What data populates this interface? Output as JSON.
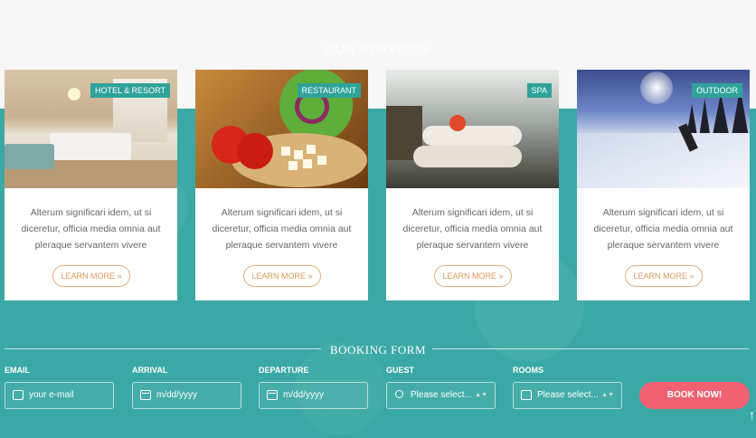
{
  "services": {
    "title": "OUR SERVICES",
    "cards": [
      {
        "tag": "HOTEL & RESORT",
        "description": "Alterum significari idem, ut si diceretur, officia media omnia aut pleraque servantem vivere",
        "button": "LEARN MORE »"
      },
      {
        "tag": "RESTAURANT",
        "description": "Alterum significari idem, ut si diceretur, officia media omnia aut pleraque servantem vivere",
        "button": "LEARN MORE »"
      },
      {
        "tag": "SPA",
        "description": "Alterum significari idem, ut si diceretur, officia media omnia aut pleraque servantem vivere",
        "button": "LEARN MORE »"
      },
      {
        "tag": "OUTDOOR",
        "description": "Alterum significari idem, ut si diceretur, officia media omnia aut pleraque servantem vivere",
        "button": "LEARN MORE »"
      }
    ]
  },
  "booking": {
    "title": "BOOKING FORM",
    "fields": [
      {
        "label": "EMAIL",
        "placeholder": "your e-mail",
        "icon": "envelope-icon"
      },
      {
        "label": "ARRIVAL",
        "placeholder": "m/dd/yyyy",
        "icon": "calendar-icon"
      },
      {
        "label": "DEPARTURE",
        "placeholder": "m/dd/yyyy",
        "icon": "calendar-icon"
      },
      {
        "label": "GUEST",
        "placeholder": "Please select...",
        "icon": "user-icon"
      },
      {
        "label": "ROOMS",
        "placeholder": "Please select...",
        "icon": "bed-icon"
      }
    ],
    "submit": "BOOK NOW!"
  },
  "colors": {
    "teal": "#3aa9a5",
    "tag": "#2fa39b",
    "button_border": "#e2b07a",
    "book": "#f06272"
  }
}
